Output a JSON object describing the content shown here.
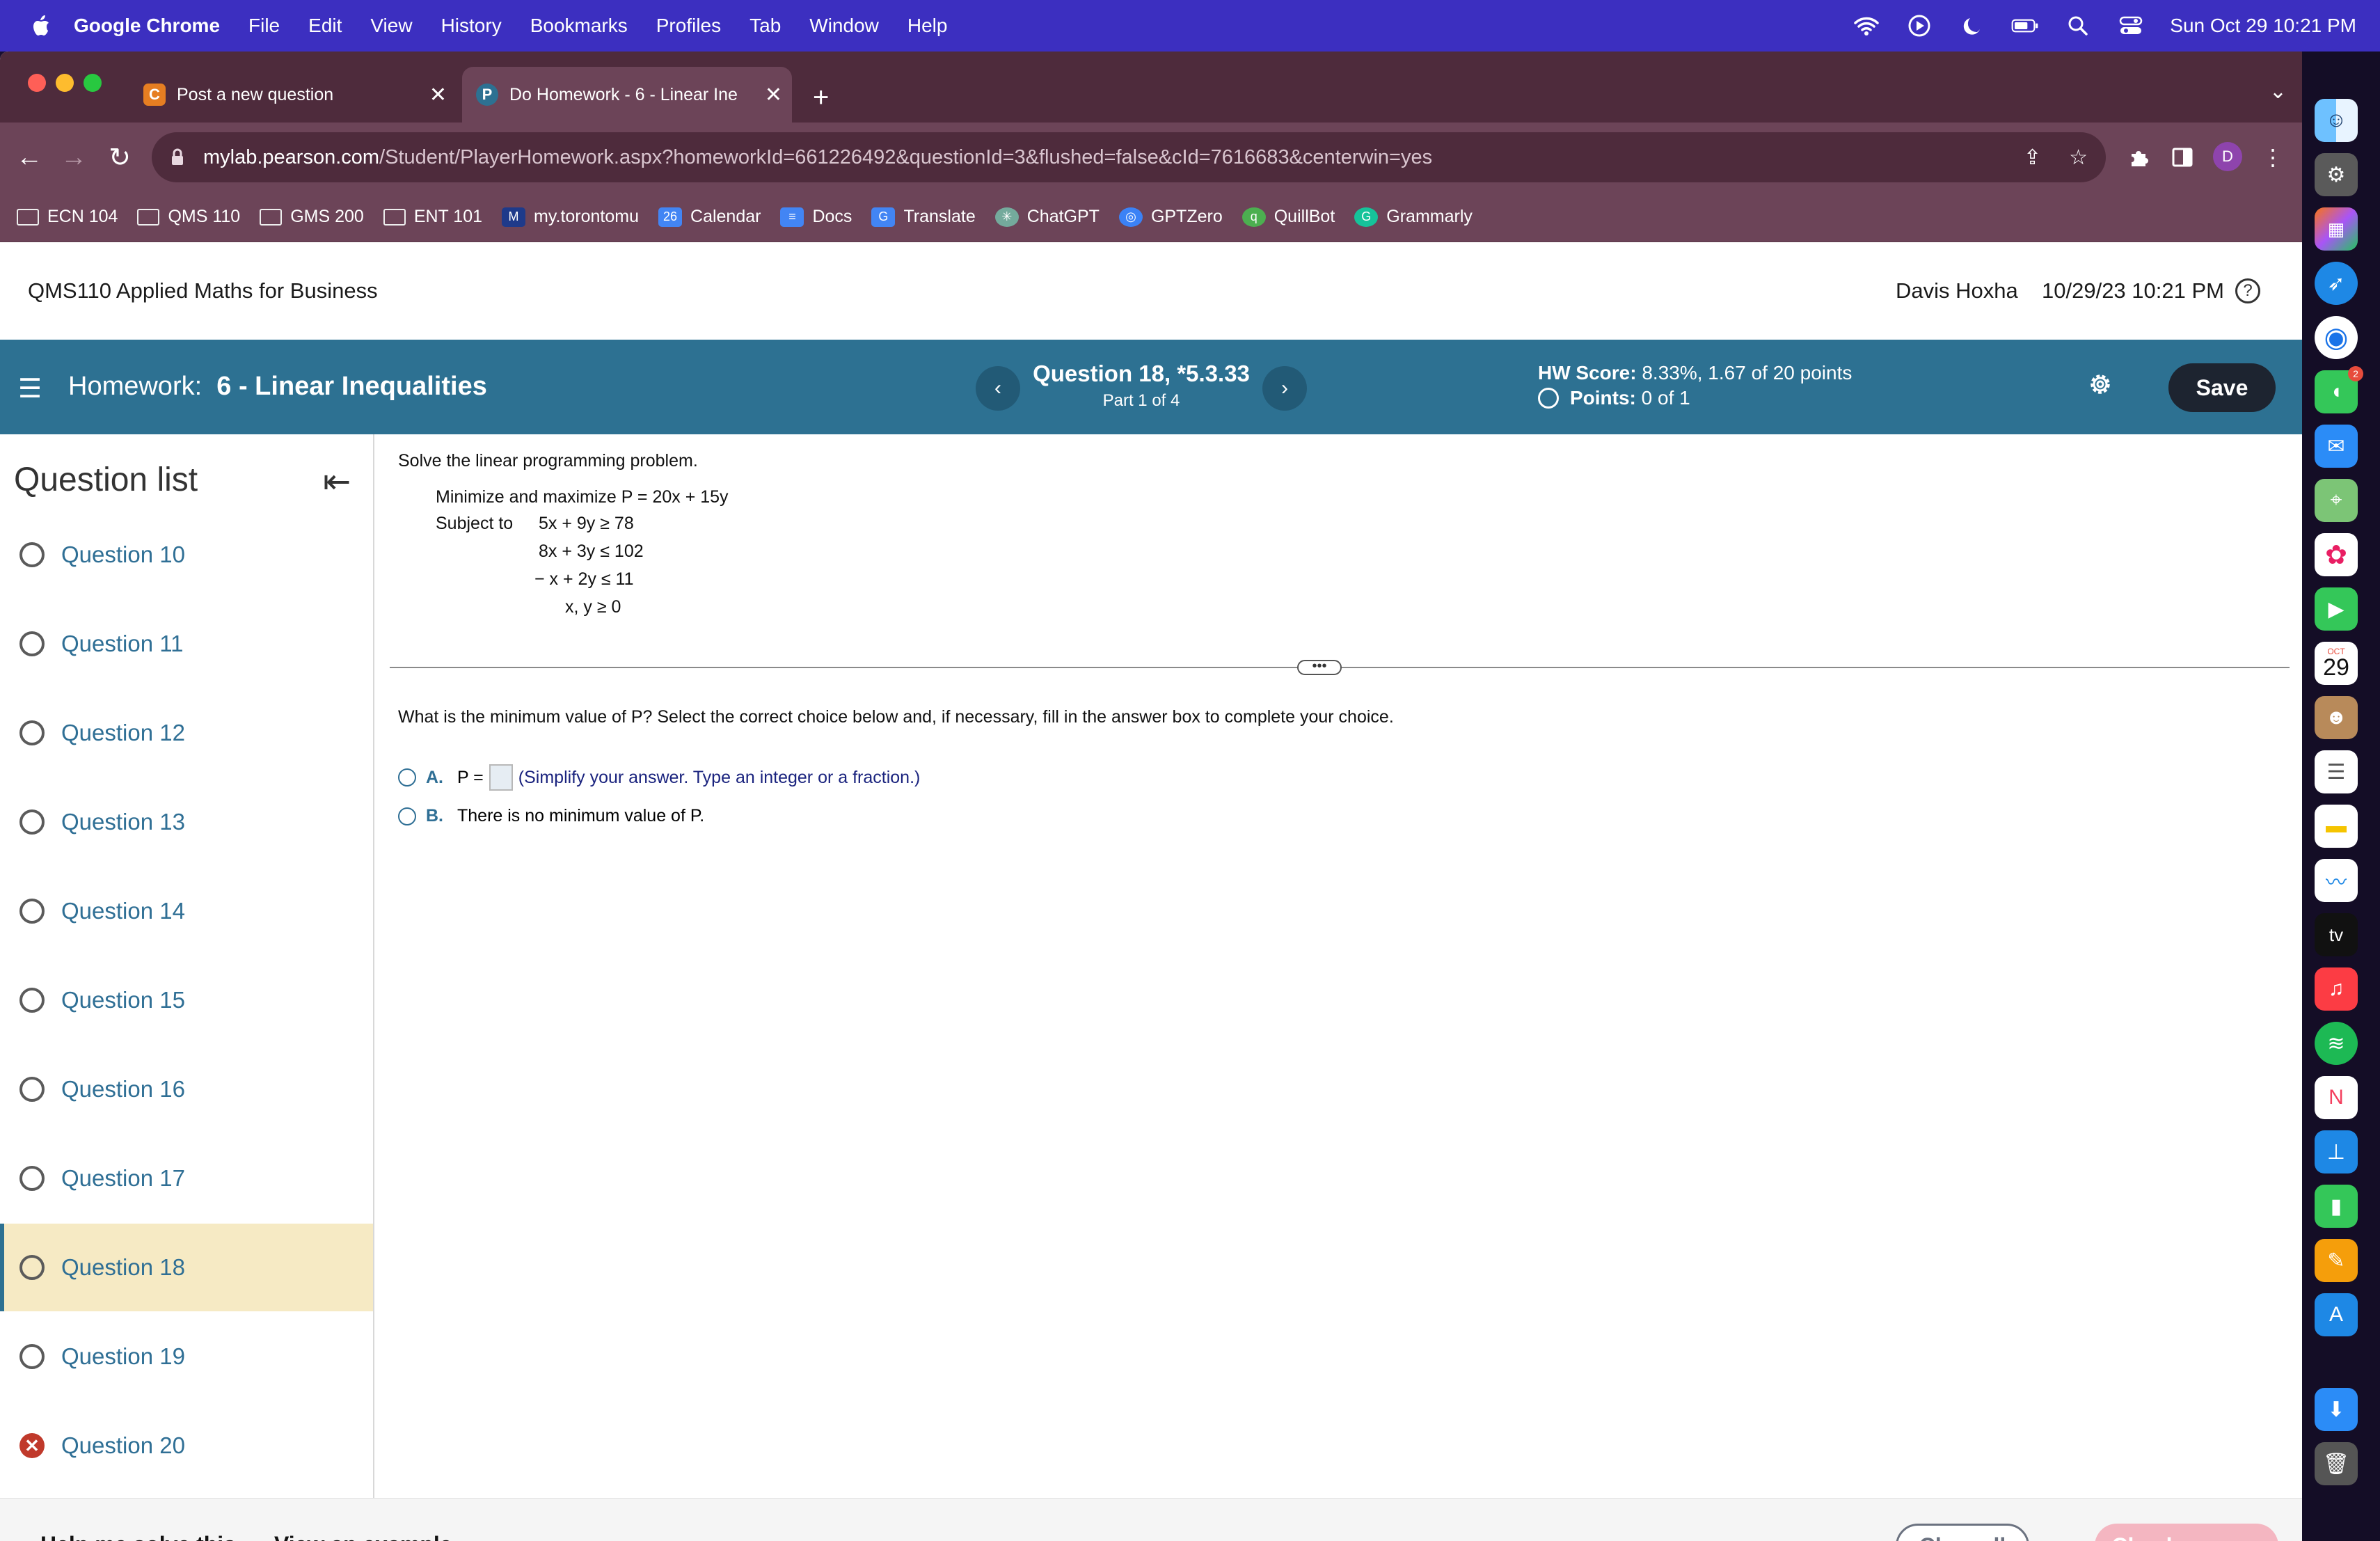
{
  "menubar": {
    "app": "Google Chrome",
    "items": [
      "File",
      "Edit",
      "View",
      "History",
      "Bookmarks",
      "Profiles",
      "Tab",
      "Window",
      "Help"
    ],
    "clock": "Sun Oct 29  10:21 PM"
  },
  "tabs": [
    {
      "title": "Post a new question",
      "favicon": "C",
      "color": "#e67e22"
    },
    {
      "title": "Do Homework - 6 - Linear Ine",
      "favicon": "P",
      "color": "#2d7192"
    }
  ],
  "omnibox": {
    "domain": "mylab.pearson.com",
    "path": "/Student/PlayerHomework.aspx?homeworkId=661226492&questionId=3&flushed=false&cId=7616683&centerwin=yes"
  },
  "profile_initial": "D",
  "bookmarks": [
    {
      "label": "ECN 104",
      "icon": "folder-icon"
    },
    {
      "label": "QMS 110",
      "icon": "folder-icon"
    },
    {
      "label": "GMS 200",
      "icon": "folder-icon"
    },
    {
      "label": "ENT 101",
      "icon": "folder-icon"
    },
    {
      "label": "my.torontomu",
      "icon": "tmu-icon",
      "glyph": "M",
      "color": "#1e3a8a"
    },
    {
      "label": "Calendar",
      "icon": "calendar-icon",
      "glyph": "26",
      "color": "#4285f4"
    },
    {
      "label": "Docs",
      "icon": "docs-icon",
      "glyph": "≡",
      "color": "#4285f4"
    },
    {
      "label": "Translate",
      "icon": "translate-icon",
      "glyph": "G",
      "color": "#4285f4"
    },
    {
      "label": "ChatGPT",
      "icon": "chatgpt-icon",
      "glyph": "✳",
      "color": "#74aa9c"
    },
    {
      "label": "GPTZero",
      "icon": "gptzero-icon",
      "glyph": "◎",
      "color": "#3b82f6"
    },
    {
      "label": "QuillBot",
      "icon": "quillbot-icon",
      "glyph": "q",
      "color": "#4caf50"
    },
    {
      "label": "Grammarly",
      "icon": "grammarly-icon",
      "glyph": "G",
      "color": "#15c39a"
    }
  ],
  "page": {
    "course": "QMS110 Applied Maths for Business",
    "user": "Davis Hoxha",
    "datetime": "10/29/23 10:21 PM",
    "help": "?"
  },
  "homework": {
    "label": "Homework:",
    "name": "6 - Linear Inequalities",
    "question": "Question 18, *5.3.33",
    "part": "Part 1 of 4",
    "score_label": "HW Score:",
    "score_value": "8.33%, 1.67 of 20 points",
    "points_label": "Points:",
    "points_value": "0 of 1",
    "save": "Save"
  },
  "sidebar": {
    "title": "Question list",
    "questions": [
      {
        "label": "Question 10",
        "status": "unanswered"
      },
      {
        "label": "Question 11",
        "status": "unanswered"
      },
      {
        "label": "Question 12",
        "status": "unanswered"
      },
      {
        "label": "Question 13",
        "status": "unanswered"
      },
      {
        "label": "Question 14",
        "status": "unanswered"
      },
      {
        "label": "Question 15",
        "status": "unanswered"
      },
      {
        "label": "Question 16",
        "status": "unanswered"
      },
      {
        "label": "Question 17",
        "status": "unanswered"
      },
      {
        "label": "Question 18",
        "status": "current"
      },
      {
        "label": "Question 19",
        "status": "unanswered"
      },
      {
        "label": "Question 20",
        "status": "incorrect"
      }
    ]
  },
  "problem": {
    "instruction": "Solve the linear programming problem.",
    "objective": "Minimize and maximize P = 20x + 15y",
    "subject_to": "Subject to",
    "constraints": [
      "5x + 9y  ≥  78",
      "8x + 3y  ≤  102",
      "− x + 2y  ≤  11",
      "x, y  ≥  0"
    ],
    "question": "What is the minimum value of P? Select the correct choice below and, if necessary, fill in the answer box to complete your choice.",
    "choices": [
      {
        "letter": "A.",
        "prefix": "P =",
        "hint": "(Simplify your answer. Type an integer or a fraction.)"
      },
      {
        "letter": "B.",
        "text": "There is no minimum value of P."
      }
    ]
  },
  "footer": {
    "help": "Help me solve this",
    "example": "View an example",
    "clear": "Clear all",
    "check": "Check answer"
  },
  "dock": {
    "calendar_month": "OCT",
    "calendar_day": "29",
    "messages_badge": "2",
    "tv_label": "tv"
  }
}
